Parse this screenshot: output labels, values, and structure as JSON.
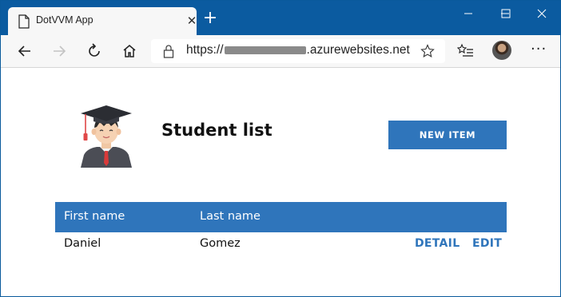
{
  "browser": {
    "tab_title": "DotVVM App",
    "url_prefix": "https://",
    "url_suffix": ".azurewebsites.net",
    "colors": {
      "titlebar": "#0b5ba0",
      "toolbar": "#f7f7f7"
    }
  },
  "page": {
    "title": "Student list",
    "new_item_label": "NEW ITEM",
    "accent_color": "#2f75bb",
    "logo_icon": "student-graduate-icon",
    "table": {
      "columns": [
        "First name",
        "Last name"
      ],
      "rows": [
        {
          "first_name": "Daniel",
          "last_name": "Gomez",
          "detail_label": "DETAIL",
          "edit_label": "EDIT"
        }
      ]
    }
  }
}
